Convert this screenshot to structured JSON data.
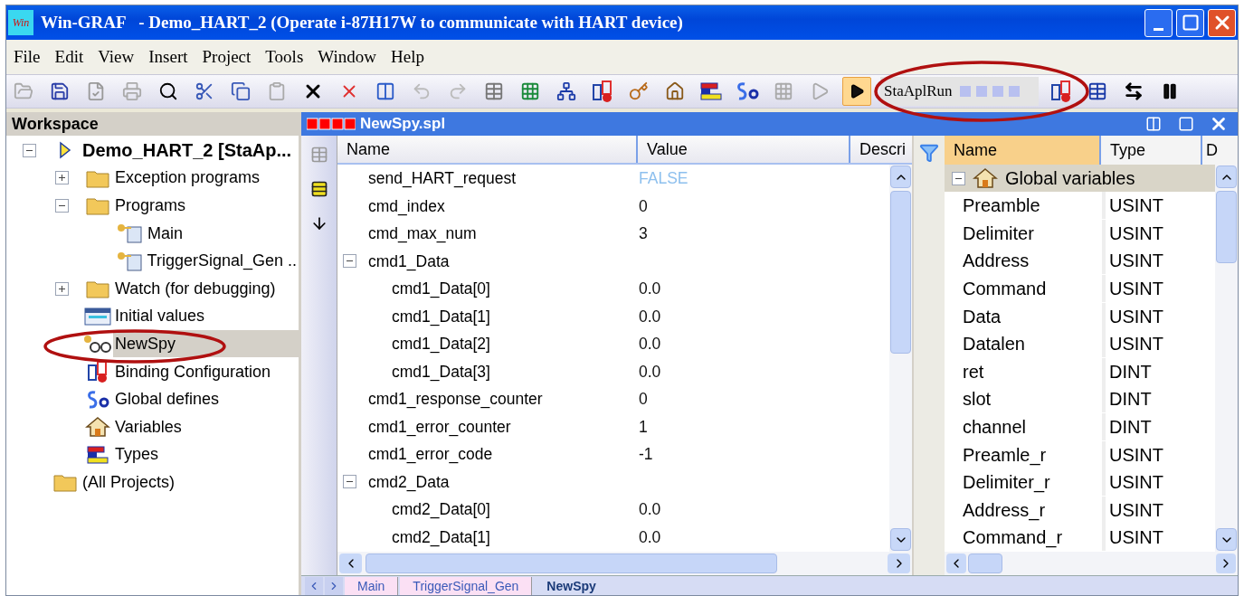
{
  "window": {
    "title": "Win-GRAF   - Demo_HART_2 (Operate i-87H17W to communicate with HART device)",
    "logo": "Win"
  },
  "menu": [
    {
      "label": "File"
    },
    {
      "label": "Edit"
    },
    {
      "label": "View"
    },
    {
      "label": "Insert"
    },
    {
      "label": "Project"
    },
    {
      "label": "Tools"
    },
    {
      "label": "Window"
    },
    {
      "label": "Help"
    }
  ],
  "toolbar": {
    "status_text": "StaAplRun",
    "run_pressed": true
  },
  "workspace": {
    "title": "Workspace",
    "tree": [
      {
        "label": "Demo_HART_2 [StaAp...",
        "kind": "project",
        "expanded": true,
        "selected": false,
        "children": [
          {
            "label": "Exception programs",
            "kind": "folder",
            "expanded": false,
            "selected": false
          },
          {
            "label": "Programs",
            "kind": "folder",
            "expanded": true,
            "selected": false,
            "children": [
              {
                "label": "Main",
                "kind": "program",
                "selected": false
              },
              {
                "label": "TriggerSignal_Gen ..",
                "kind": "program",
                "selected": false
              }
            ]
          },
          {
            "label": "Watch (for debugging)",
            "kind": "folder",
            "expanded": false,
            "selected": false
          },
          {
            "label": "Initial values",
            "kind": "init",
            "selected": false
          },
          {
            "label": "NewSpy",
            "kind": "spy",
            "selected": true
          },
          {
            "label": "Binding Configuration",
            "kind": "binding",
            "selected": false
          },
          {
            "label": "Global defines",
            "kind": "defines",
            "selected": false
          },
          {
            "label": "Variables",
            "kind": "variables",
            "selected": false
          },
          {
            "label": "Types",
            "kind": "types",
            "selected": false
          }
        ]
      },
      {
        "label": "(All Projects)",
        "kind": "folder",
        "selected": false
      }
    ]
  },
  "spy": {
    "title": "NewSpy.spl",
    "columns": [
      "Name",
      "Value",
      "Descri"
    ],
    "rows": [
      {
        "name": "send_HART_request",
        "value": "FALSE",
        "kind": "bool"
      },
      {
        "name": "cmd_index",
        "value": "0",
        "kind": "number"
      },
      {
        "name": "cmd_max_num",
        "value": "3",
        "kind": "number"
      },
      {
        "name": "cmd1_Data",
        "kind": "group",
        "expanded": true,
        "children": [
          {
            "name": "cmd1_Data[0]",
            "value": "0.0",
            "kind": "number"
          },
          {
            "name": "cmd1_Data[1]",
            "value": "0.0",
            "kind": "number"
          },
          {
            "name": "cmd1_Data[2]",
            "value": "0.0",
            "kind": "number"
          },
          {
            "name": "cmd1_Data[3]",
            "value": "0.0",
            "kind": "number"
          }
        ]
      },
      {
        "name": "cmd1_response_counter",
        "value": "0",
        "kind": "number"
      },
      {
        "name": "cmd1_error_counter",
        "value": "1",
        "kind": "number"
      },
      {
        "name": "cmd1_error_code",
        "value": "-1",
        "kind": "number"
      },
      {
        "name": "cmd2_Data",
        "kind": "group",
        "expanded": true,
        "children": [
          {
            "name": "cmd2_Data[0]",
            "value": "0.0",
            "kind": "number"
          },
          {
            "name": "cmd2_Data[1]",
            "value": "0.0",
            "kind": "number"
          }
        ]
      }
    ]
  },
  "variables": {
    "columns": [
      "Name",
      "Type",
      "D"
    ],
    "group": {
      "label": "Global variables",
      "expanded": true
    },
    "rows": [
      {
        "name": "Preamble",
        "type": "USINT"
      },
      {
        "name": "Delimiter",
        "type": "USINT"
      },
      {
        "name": "Address",
        "type": "USINT"
      },
      {
        "name": "Command",
        "type": "USINT"
      },
      {
        "name": "Data",
        "type": "USINT"
      },
      {
        "name": "Datalen",
        "type": "USINT"
      },
      {
        "name": "ret",
        "type": "DINT"
      },
      {
        "name": "slot",
        "type": "DINT"
      },
      {
        "name": "channel",
        "type": "DINT"
      },
      {
        "name": "Preamle_r",
        "type": "USINT"
      },
      {
        "name": "Delimiter_r",
        "type": "USINT"
      },
      {
        "name": "Address_r",
        "type": "USINT"
      },
      {
        "name": "Command_r",
        "type": "USINT"
      }
    ]
  },
  "editor_tabs": [
    {
      "label": "Main",
      "selected": false
    },
    {
      "label": "TriggerSignal_Gen",
      "selected": false
    },
    {
      "label": "NewSpy",
      "selected": true
    }
  ]
}
